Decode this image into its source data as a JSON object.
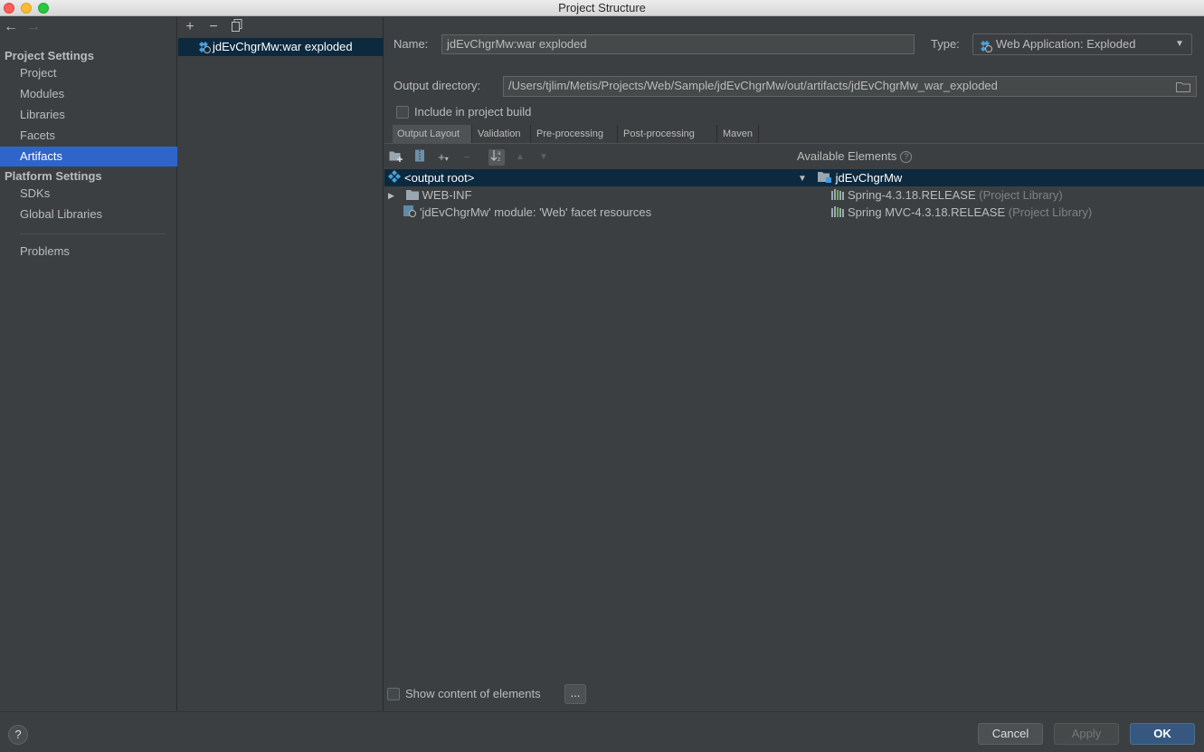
{
  "window": {
    "title": "Project Structure"
  },
  "sidebar": {
    "back_icon": "arrow-left-icon",
    "forward_icon": "arrow-right-icon",
    "project_settings_title": "Project Settings",
    "project_items": [
      "Project",
      "Modules",
      "Libraries",
      "Facets",
      "Artifacts"
    ],
    "selected": "Artifacts",
    "platform_settings_title": "Platform Settings",
    "platform_items": [
      "SDKs",
      "Global Libraries"
    ],
    "problems": "Problems"
  },
  "artifacts": {
    "toolbar": {
      "add": "+",
      "remove": "−",
      "copy": "copy-icon"
    },
    "items": [
      "jdEvChgrMw:war exploded"
    ]
  },
  "form": {
    "name_label": "Name:",
    "name_value": "jdEvChgrMw:war exploded",
    "type_label": "Type:",
    "type_value": "Web Application: Exploded",
    "output_dir_label": "Output directory:",
    "output_dir_value": "/Users/tjlim/Metis/Projects/Web/Sample/jdEvChgrMw/out/artifacts/jdEvChgrMw_war_exploded",
    "include_build_label": "Include in project build",
    "include_build_checked": false
  },
  "tabs": [
    "Output Layout",
    "Validation",
    "Pre-processing",
    "Post-processing",
    "Maven"
  ],
  "active_tab": "Output Layout",
  "output_layout": {
    "rows": [
      {
        "label": "<output root>",
        "selected": true
      },
      {
        "label": "WEB-INF",
        "expandable": true
      },
      {
        "label": "'jdEvChgrMw' module: 'Web' facet resources"
      }
    ]
  },
  "available_elements": {
    "title": "Available Elements",
    "help": "?",
    "root": "jdEvChgrMw",
    "libraries": [
      {
        "name": "Spring-4.3.18.RELEASE",
        "kind": "(Project Library)"
      },
      {
        "name": "Spring MVC-4.3.18.RELEASE",
        "kind": "(Project Library)"
      }
    ]
  },
  "footer": {
    "show_content_label": "Show content of elements",
    "ellipsis": "...",
    "help": "?",
    "cancel": "Cancel",
    "apply": "Apply",
    "ok": "OK"
  },
  "colors": {
    "background": "#3c3f41",
    "selection": "#2f65ca",
    "tree_selection": "#0d293e",
    "primary_button": "#365880"
  }
}
